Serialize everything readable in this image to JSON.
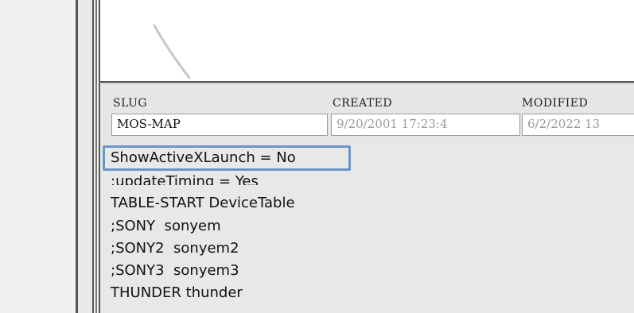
{
  "fields": {
    "slug": {
      "label": "SLUG",
      "value": "MOS-MAP"
    },
    "created": {
      "label": "CREATED",
      "value": "9/20/2001 17:23:4"
    },
    "modified": {
      "label": "MODIFIED",
      "value": "6/2/2022 13"
    }
  },
  "config_lines": [
    "ShowActiveXLaunch = No",
    ";updateTiming = Yes",
    "TABLE-START DeviceTable",
    ";SONY  sonyem",
    ";SONY2  sonyem2",
    ";SONY3  sonyem3",
    "THUNDER thunder",
    "  ...      ...        ..."
  ],
  "colors": {
    "highlight": "#6a95c6",
    "frame": "#555555",
    "panel": "#e6e6e6"
  }
}
